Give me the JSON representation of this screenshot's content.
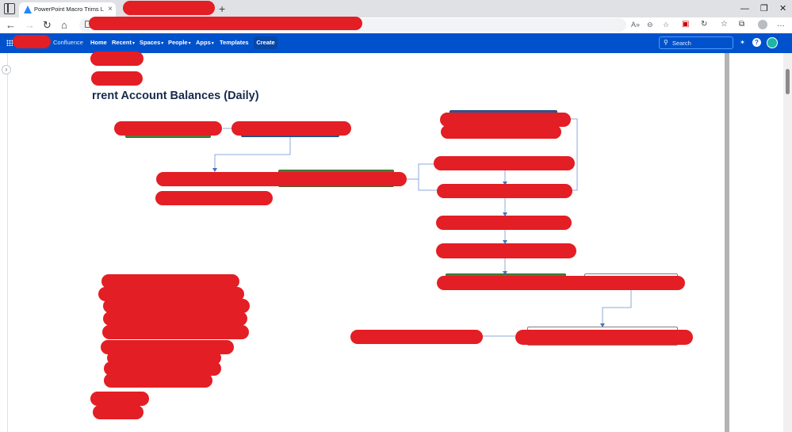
{
  "browser": {
    "tab_title": "PowerPoint Macro Trims Left Sid",
    "tab_close": "×",
    "new_tab": "+",
    "window_controls": [
      "—",
      "❐",
      "✕"
    ],
    "nav": {
      "back": "←",
      "forward": "→",
      "refresh": "↻",
      "home": "⌂"
    },
    "omnibox_icons": [
      "A»",
      "⊖",
      "☆"
    ],
    "toolbar_icons": [
      "▣",
      "↻",
      "☆",
      "⧉",
      "…"
    ]
  },
  "confluence": {
    "brand": "Confluence",
    "nav": [
      {
        "label": "Home",
        "caret": false
      },
      {
        "label": "Recent",
        "caret": true
      },
      {
        "label": "Spaces",
        "caret": true
      },
      {
        "label": "People",
        "caret": true
      },
      {
        "label": "Apps",
        "caret": true
      },
      {
        "label": "Templates",
        "caret": false
      }
    ],
    "create_label": "Create",
    "search_placeholder": "Search",
    "search_icon": "search-icon",
    "bar_icons": [
      "notifications-icon",
      "help-icon"
    ]
  },
  "page": {
    "heading": "rrent Account Balances (Daily)",
    "heading_bottom": "...",
    "expander_glyph": "›"
  },
  "colors": {
    "confluence_blue": "#0052cc",
    "create_button": "#0747a6",
    "redaction": "#e31e24",
    "connector": "#8eaadb",
    "node_green": "#4a7f3a",
    "node_blue": "#2f5597"
  }
}
